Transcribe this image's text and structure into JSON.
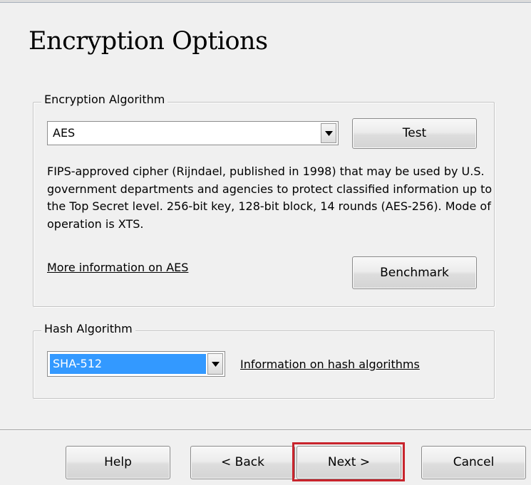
{
  "page": {
    "title": "Encryption Options"
  },
  "encryption": {
    "group_label": "Encryption Algorithm",
    "selected": "AES",
    "test_label": "Test",
    "description": "FIPS-approved cipher (Rijndael, published in 1998) that may be used by U.S. government departments and agencies to protect classified information up to the Top Secret level. 256-bit key, 128-bit block, 14 rounds (AES-256). Mode of operation is XTS.",
    "more_info_link": "More information on AES",
    "benchmark_label": "Benchmark"
  },
  "hash": {
    "group_label": "Hash Algorithm",
    "selected": "SHA-512",
    "info_link": "Information on hash algorithms"
  },
  "footer": {
    "help_label": "Help",
    "back_label": "< Back",
    "next_label": "Next >",
    "cancel_label": "Cancel"
  },
  "icons": {
    "dropdown": "chevron-down-icon"
  },
  "colors": {
    "selection_bg": "#3399ff",
    "highlight_border": "#c8242c"
  }
}
